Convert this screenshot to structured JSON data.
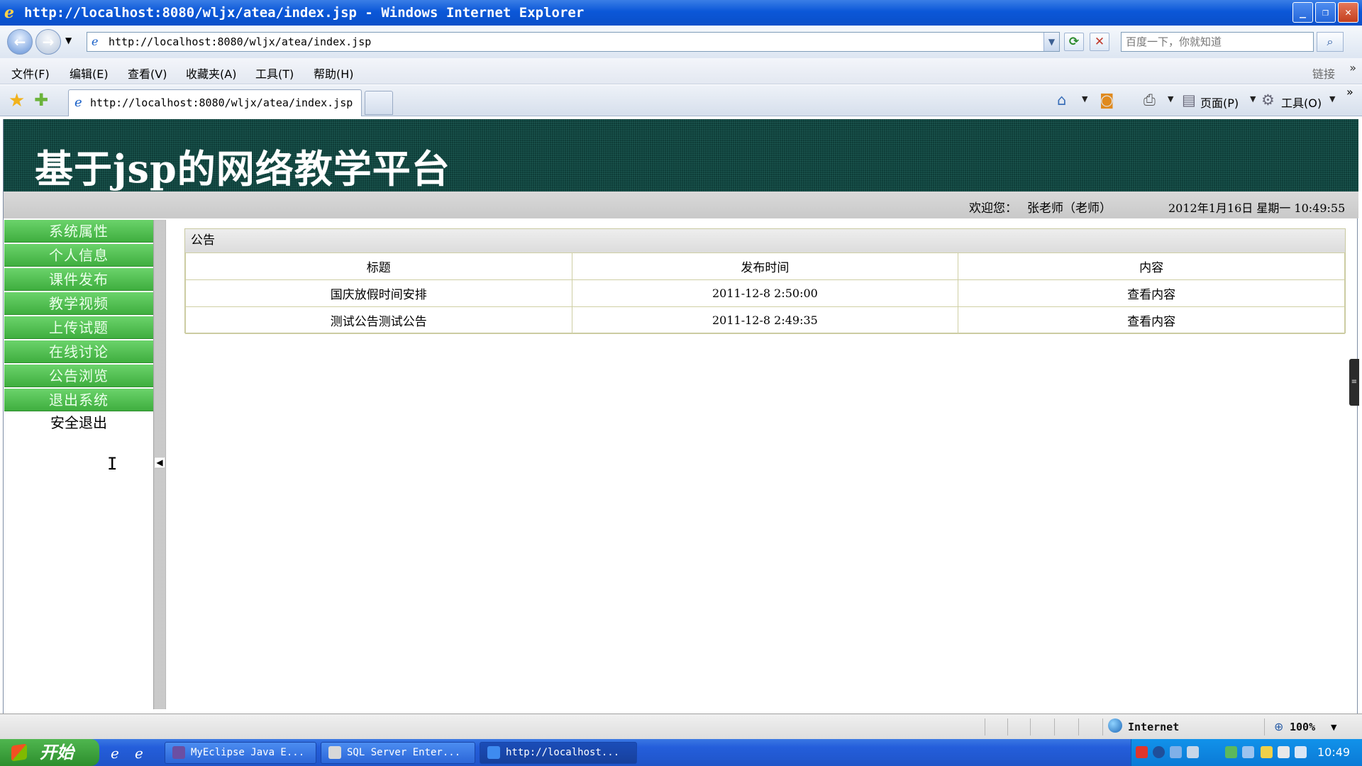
{
  "window": {
    "title": "http://localhost:8080/wljx/atea/index.jsp - Windows Internet Explorer",
    "controls": [
      "_",
      "❐",
      "✕"
    ]
  },
  "address_bar": {
    "url": "http://localhost:8080/wljx/atea/index.jsp",
    "search_placeholder": "百度一下，你就知道"
  },
  "menu": {
    "items": [
      "文件(F)",
      "编辑(E)",
      "查看(V)",
      "收藏夹(A)",
      "工具(T)",
      "帮助(H)"
    ],
    "links_label": "链接",
    "overflow": "»"
  },
  "tabs": {
    "active_title": "http://localhost:8080/wljx/atea/index.jsp"
  },
  "command_bar": {
    "page_label": "页面(P)",
    "tools_label": "工具(O)"
  },
  "site": {
    "title": "基于jsp的网络教学平台",
    "welcome_label": "欢迎您：",
    "user": "张老师（老师）",
    "datetime": "2012年1月16日  星期一  10:49:55"
  },
  "sidebar": {
    "items": [
      "系统属性",
      "个人信息",
      "课件发布",
      "教学视频",
      "上传试题",
      "在线讨论",
      "公告浏览",
      "退出系统"
    ],
    "plain_item": "安全退出"
  },
  "notices": {
    "heading": "公告",
    "columns": [
      "标题",
      "发布时间",
      "内容"
    ],
    "rows": [
      {
        "title": "国庆放假时间安排",
        "time": "2011-12-8 2:50:00",
        "action": "查看内容"
      },
      {
        "title": "测试公告测试公告",
        "time": "2011-12-8 2:49:35",
        "action": "查看内容"
      }
    ]
  },
  "status_bar": {
    "zone": "Internet",
    "zoom": "100%"
  },
  "taskbar": {
    "start_label": "开始",
    "tasks": [
      "MyEclipse Java E...",
      "SQL Server Enter...",
      "http://localhost..."
    ],
    "clock": "10:49"
  },
  "colors": {
    "banner_bg": "#0e3d38",
    "sidebar_green": "#4fc04f",
    "taskbar_blue": "#245edb"
  }
}
